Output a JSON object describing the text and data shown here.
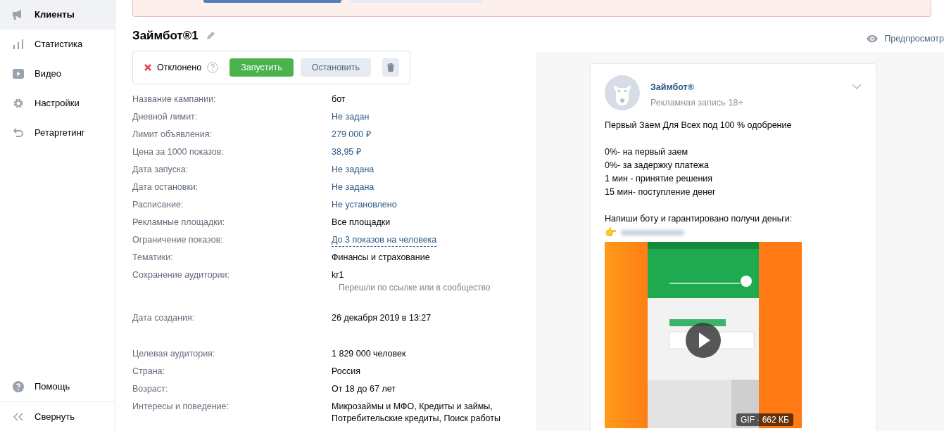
{
  "sidebar": {
    "items": [
      {
        "label": "Клиенты",
        "selected": true
      },
      {
        "label": "Статистика",
        "selected": false
      },
      {
        "label": "Видео",
        "selected": false
      },
      {
        "label": "Настройки",
        "selected": false
      },
      {
        "label": "Ретаргетинг",
        "selected": false
      }
    ],
    "footer": [
      {
        "label": "Помощь"
      },
      {
        "label": "Свернуть"
      }
    ]
  },
  "campaign": {
    "title": "Займбот®1",
    "status": {
      "kind": "rejected",
      "label": "Отклонено"
    },
    "buttons": [
      {
        "label": "Запустить",
        "kind": "primary"
      },
      {
        "label": "Остановить",
        "kind": "secondary"
      }
    ],
    "sections": [
      [
        {
          "label": "Название кампании:",
          "value": "бот",
          "kind": "text"
        },
        {
          "label": "Дневной лимит:",
          "value": "Не задан",
          "kind": "link"
        },
        {
          "label": "Лимит объявления:",
          "value": "279 000 ₽",
          "kind": "link"
        },
        {
          "label": "Цена за 1000 показов:",
          "value": "38,95 ₽",
          "kind": "link"
        },
        {
          "label": "Дата запуска:",
          "value": "Не задана",
          "kind": "link"
        },
        {
          "label": "Дата остановки:",
          "value": "Не задана",
          "kind": "link"
        },
        {
          "label": "Расписание:",
          "value": "Не установлено",
          "kind": "link"
        },
        {
          "label": "Рекламные площадки:",
          "value": "Все площадки",
          "kind": "text"
        },
        {
          "label": "Ограничение показов:",
          "value": "До 3 показов на человека",
          "kind": "dashed"
        },
        {
          "label": "Тематики:",
          "value": "Финансы и страхование",
          "kind": "text"
        },
        {
          "label": "Сохранение аудитории:",
          "value": "kr1",
          "note": "Перешли по ссылке или в сообщество",
          "kind": "text"
        }
      ],
      [
        {
          "label": "Дата создания:",
          "value": "26 декабря 2019 в 13:27",
          "kind": "text"
        }
      ],
      [
        {
          "label": "Целевая аудитория:",
          "value": "1 829 000 человек",
          "kind": "text"
        },
        {
          "label": "Страна:",
          "value": "Россия",
          "kind": "text"
        },
        {
          "label": "Возраст:",
          "value": "От 18 до 67 лет",
          "kind": "text"
        },
        {
          "label": "Интересы и поведение:",
          "value": "Микрозаймы и МФО, Кредиты и займы, Потребительские кредиты, Поиск работы",
          "kind": "text"
        }
      ]
    ]
  },
  "preview": {
    "label": "Предпросмотр",
    "post": {
      "author": "Займбот®",
      "subtitle": "Рекламная запись",
      "age": "18+",
      "paragraphs": [
        [
          "Первый Заем Для Всех под 100 % одобрение"
        ],
        [
          "0%- на первый заем",
          "0%- за задержку платежа",
          "1 мин - принятие решения",
          "15 мин- поступление денег"
        ],
        [
          "Напиши боту и гарантировано получи деньги:"
        ]
      ],
      "pointer": "👉",
      "media": {
        "kind": "picture",
        "badge": "GIF · 662 КБ"
      }
    }
  }
}
